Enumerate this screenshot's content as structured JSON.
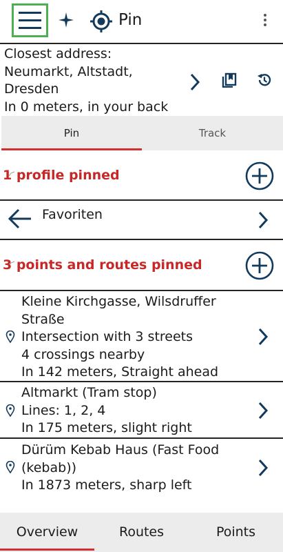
{
  "appbar": {
    "title": "Pin",
    "menu_icon": "hamburger-menu-icon",
    "compass_icon": "compass-star-icon",
    "location_icon": "gps-target-icon",
    "overflow_icon": "more-vert-icon"
  },
  "address": {
    "lines": "Closest address:\nNeumarkt, Altstadt,\nDresden\nIn 0 meters, in your back",
    "details_icon": "chevron-right-icon",
    "bookmark_icon": "bookmark-icon",
    "history_icon": "history-icon"
  },
  "tabs": [
    {
      "label": "Pin",
      "selected": true
    },
    {
      "label": "Track",
      "selected": false
    }
  ],
  "profiles": {
    "title": "1 profile pinned",
    "add_icon": "add-circle-icon"
  },
  "favorites": {
    "back_icon": "arrow-left-icon",
    "label": "Favoriten",
    "next_icon": "chevron-right-icon"
  },
  "points": {
    "title": "3 points and routes pinned",
    "add_icon": "add-circle-icon",
    "items": [
      {
        "text": "Kleine Kirchgasse, Wilsdruffer\nStraße\nIntersection with 3 streets\n4 crossings nearby\nIn 142 meters, Straight ahead",
        "icon": "location-pin-icon"
      },
      {
        "text": "Altmarkt (Tram stop)\nLines: 1, 2, 4\nIn 175 meters, slight right",
        "icon": "location-pin-icon"
      },
      {
        "text": "Dürüm Kebab Haus (Fast Food\n(kebab))\nIn 1873 meters, sharp left",
        "icon": "location-pin-icon"
      }
    ]
  },
  "bottom_nav": [
    {
      "label": "Overview",
      "selected": true
    },
    {
      "label": "Routes",
      "selected": false
    },
    {
      "label": "Points",
      "selected": false
    }
  ],
  "colors": {
    "accent": "#d32f2f",
    "icon": "#123a5c",
    "menu_highlight": "#4caf50"
  }
}
